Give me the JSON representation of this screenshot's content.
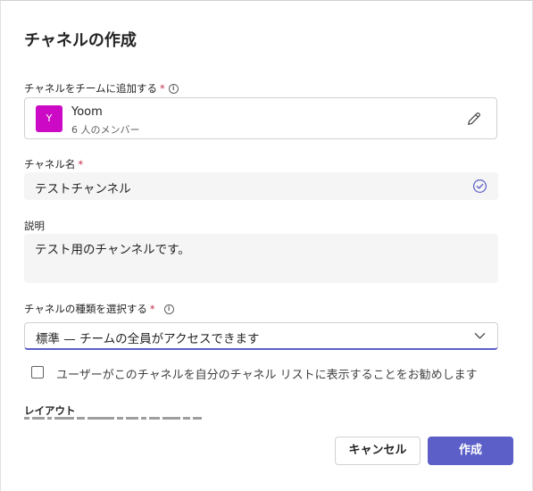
{
  "dialog": {
    "title": "チャネルの作成",
    "team_section": {
      "label": "チャネルをチームに追加する",
      "required_mark": "*",
      "info_icon": "info-icon",
      "team": {
        "avatar_letter": "Y",
        "avatar_color": "#cc0ac6",
        "name": "Yoom",
        "members": "6 人のメンバー"
      },
      "edit_icon": "pencil-icon"
    },
    "channel_name": {
      "label": "チャネル名",
      "required_mark": "*",
      "value": "テストチャンネル",
      "status_icon": "check-circle-icon"
    },
    "description": {
      "label": "説明",
      "value": "テスト用のチャンネルです。"
    },
    "channel_type": {
      "label": "チャネルの種類を選択する",
      "required_mark": "*",
      "info_icon": "info-icon",
      "selected": "標準 — チームの全員がアクセスできます"
    },
    "show_in_list": {
      "checked": false,
      "label": "ユーザーがこのチャネルを自分のチャネル リストに表示することをお勧めします"
    },
    "layout": {
      "label": "レイアウト"
    },
    "buttons": {
      "cancel": "キャンセル",
      "create": "作成"
    },
    "colors": {
      "accent": "#5b5fc7",
      "required": "#c4314b"
    }
  }
}
